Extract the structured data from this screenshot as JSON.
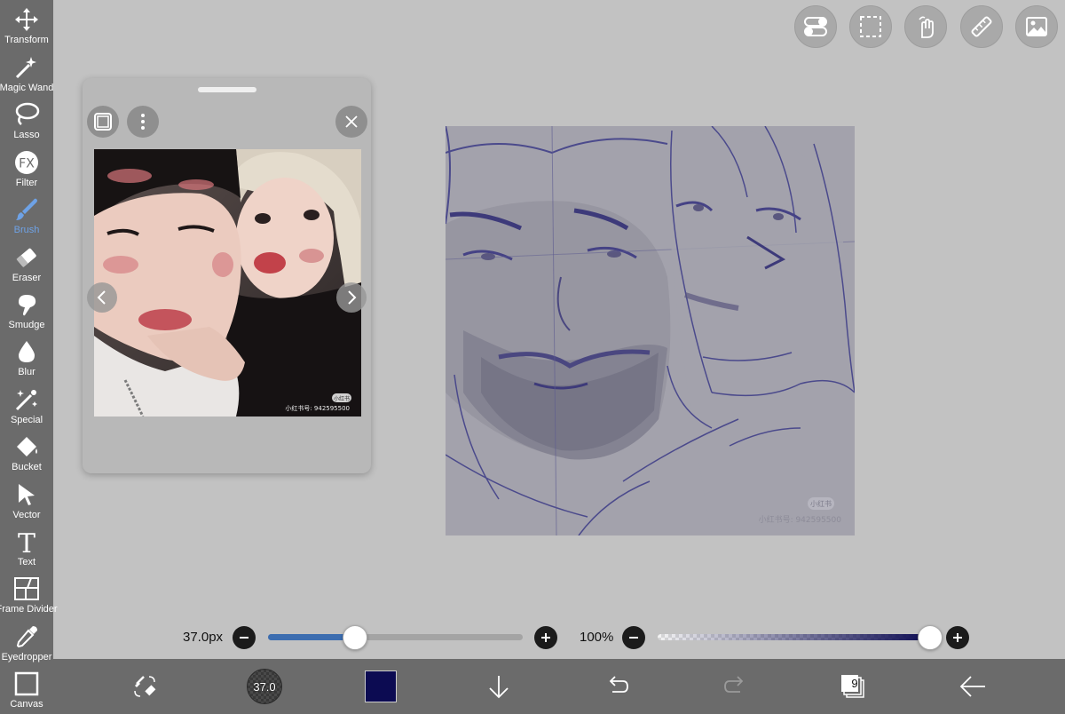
{
  "toolbar": {
    "items": [
      {
        "label": "Transform",
        "icon": "transform-icon"
      },
      {
        "label": "Magic Wand",
        "icon": "magic-wand-icon"
      },
      {
        "label": "Lasso",
        "icon": "lasso-icon"
      },
      {
        "label": "Filter",
        "icon": "fx-icon",
        "icon_text": "FX"
      },
      {
        "label": "Brush",
        "icon": "brush-icon",
        "active": true
      },
      {
        "label": "Eraser",
        "icon": "eraser-icon"
      },
      {
        "label": "Smudge",
        "icon": "smudge-icon"
      },
      {
        "label": "Blur",
        "icon": "blur-drop-icon"
      },
      {
        "label": "Special",
        "icon": "special-wand-icon"
      },
      {
        "label": "Bucket",
        "icon": "bucket-icon"
      },
      {
        "label": "Vector",
        "icon": "vector-cursor-icon"
      },
      {
        "label": "Text",
        "icon": "text-icon",
        "icon_text": "T"
      },
      {
        "label": "Frame Divider",
        "icon": "frame-divider-icon"
      },
      {
        "label": "Eyedropper",
        "icon": "eyedropper-icon"
      },
      {
        "label": "Canvas",
        "icon": "canvas-icon"
      }
    ],
    "active_color": "#6ea2e6"
  },
  "top_buttons": [
    "toggle-icon",
    "selection-icon",
    "touch-hand-icon",
    "ruler-icon",
    "gallery-icon"
  ],
  "reference_window": {
    "photo_watermark": "小红书",
    "photo_caption": "小红书号: 942595500"
  },
  "artwork": {
    "watermark": "小红书",
    "caption": "小红书号: 942595500"
  },
  "brush_size": {
    "label": "37.0px",
    "fraction": 0.34
  },
  "opacity": {
    "label": "100%",
    "fraction": 1.0
  },
  "bottom_bar": {
    "brush_preview_label": "37.0",
    "current_color": "#0c0b52",
    "layer_count": "9"
  }
}
